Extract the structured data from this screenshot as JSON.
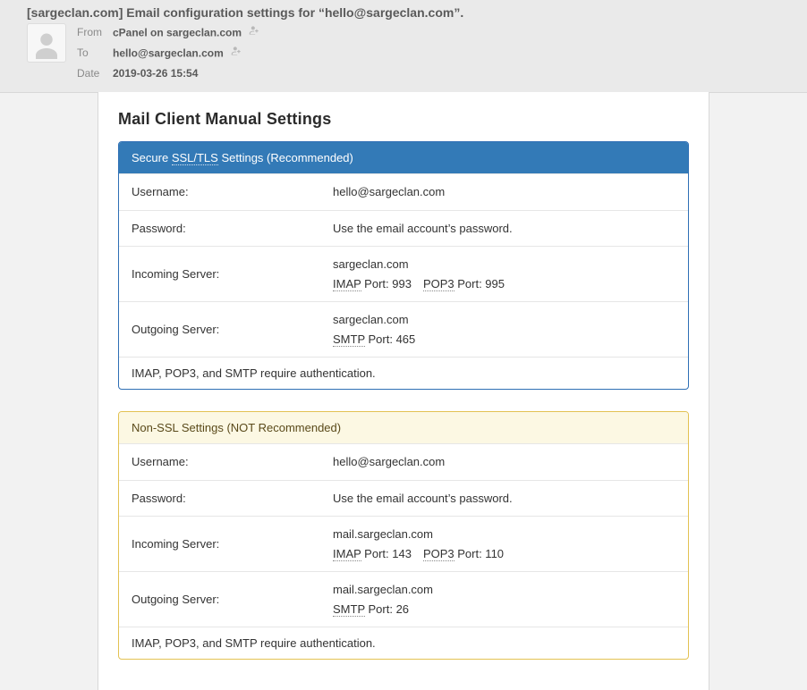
{
  "email": {
    "subject": "[sargeclan.com] Email configuration settings for “hello@sargeclan.com”.",
    "from_label": "From",
    "to_label": "To",
    "date_label": "Date",
    "from_value": "cPanel on sargeclan.com",
    "to_value": "hello@sargeclan.com",
    "date_value": "2019-03-26 15:54"
  },
  "title": "Mail Client Manual Settings",
  "secure": {
    "heading_pre": "Secure ",
    "heading_abbr": "SSL/TLS",
    "heading_post": " Settings (Recommended)",
    "username_label": "Username:",
    "username_value": "hello@sargeclan.com",
    "password_label": "Password:",
    "password_value": "Use the email account’s password.",
    "incoming_label": "Incoming Server:",
    "incoming_host": "sargeclan.com",
    "imap_abbr": "IMAP",
    "imap_port_text": " Port: 993 ",
    "pop3_abbr": "POP3",
    "pop3_port_text": " Port: 995",
    "outgoing_label": "Outgoing Server:",
    "outgoing_host": "sargeclan.com",
    "smtp_abbr": "SMTP",
    "smtp_port_text": " Port: 465",
    "footer": "IMAP, POP3, and SMTP require authentication."
  },
  "nonssl": {
    "heading": "Non-SSL Settings (NOT Recommended)",
    "username_label": "Username:",
    "username_value": "hello@sargeclan.com",
    "password_label": "Password:",
    "password_value": "Use the email account’s password.",
    "incoming_label": "Incoming Server:",
    "incoming_host": "mail.sargeclan.com",
    "imap_abbr": "IMAP",
    "imap_port_text": " Port: 143 ",
    "pop3_abbr": "POP3",
    "pop3_port_text": " Port: 110",
    "outgoing_label": "Outgoing Server:",
    "outgoing_host": "mail.sargeclan.com",
    "smtp_abbr": "SMTP",
    "smtp_port_text": " Port: 26",
    "footer": "IMAP, POP3, and SMTP require authentication."
  }
}
